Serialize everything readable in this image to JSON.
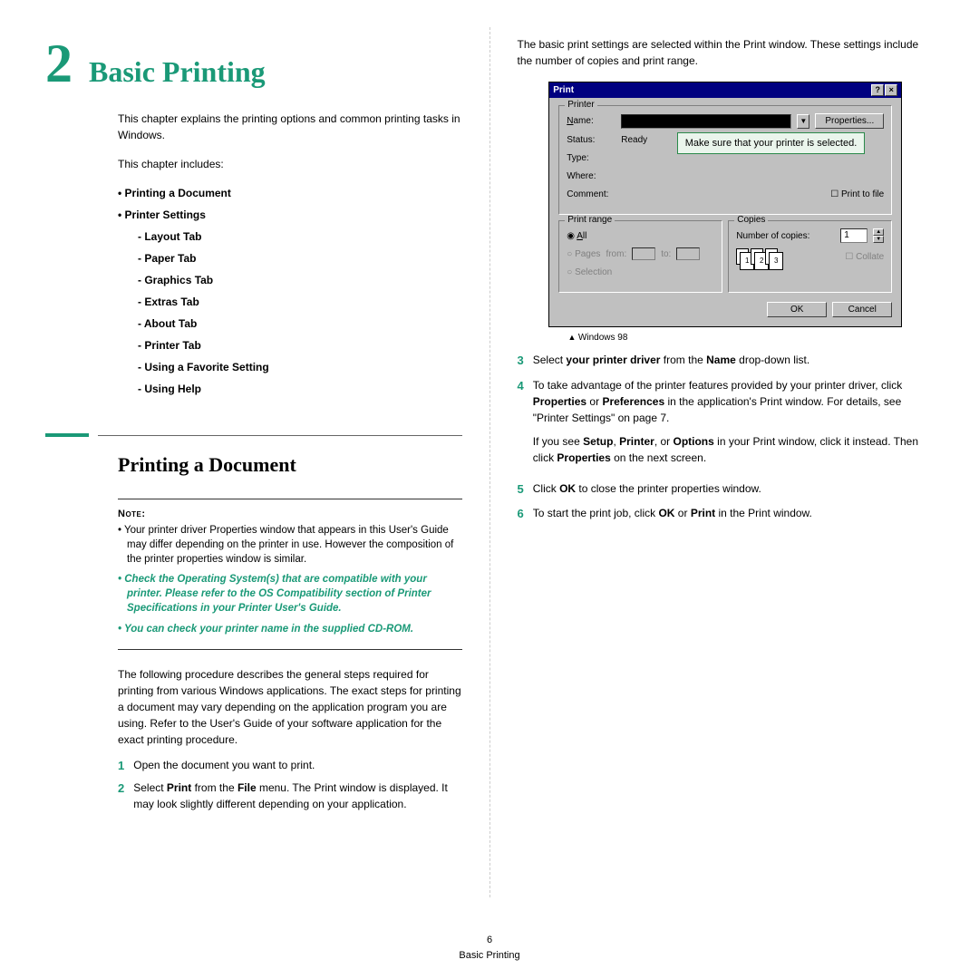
{
  "chapter": {
    "num": "2",
    "title": "Basic Printing"
  },
  "intro1": "This chapter explains the printing options and common printing tasks in Windows.",
  "intro2": "This chapter includes:",
  "toc": {
    "i1": "Printing a Document",
    "i2": "Printer Settings",
    "s1": "Layout Tab",
    "s2": "Paper Tab",
    "s3": "Graphics Tab",
    "s4": "Extras Tab",
    "s5": "About Tab",
    "s6": "Printer Tab",
    "s7": "Using a Favorite Setting",
    "s8": "Using Help"
  },
  "section1": "Printing a Document",
  "note_label": "Note:",
  "note": {
    "n1": "Your printer driver Properties window that appears in this User's Guide may differ depending on the printer in use. However the composition of the printer properties window is similar.",
    "n2": "Check the Operating System(s) that are compatible with your printer. Please refer to the OS Compatibility section of Printer Specifications in your Printer User's Guide.",
    "n3": "You can check your printer name in the supplied CD-ROM."
  },
  "para1": "The following procedure describes the general steps required for printing from various Windows applications. The exact steps for printing a document may vary depending on the application program you are using. Refer to the User's Guide of your software application for the exact printing procedure.",
  "step1": "Open the document you want to print.",
  "step2_a": "Select ",
  "step2_b": "Print",
  "step2_c": " from the ",
  "step2_d": "File",
  "step2_e": " menu. The Print window is displayed. It may look slightly different depending on your application.",
  "col2_top": "The basic print settings are selected within the Print window. These settings include the number of copies and print range.",
  "dlg": {
    "title": "Print",
    "printer": "Printer",
    "name": "Name:",
    "properties": "Properties...",
    "status": "Status:",
    "status_v": "Ready",
    "type": "Type:",
    "where": "Where:",
    "comment": "Comment:",
    "print_to_file": "Print to file",
    "print_range": "Print range",
    "all": "All",
    "pages": "Pages",
    "from": "from:",
    "to": "to:",
    "selection": "Selection",
    "copies": "Copies",
    "num_copies": "Number of copies:",
    "copies_v": "1",
    "collate": "Collate",
    "ok": "OK",
    "cancel": "Cancel",
    "callout": "Make sure that your printer is selected."
  },
  "caption": "Windows 98",
  "s3_a": "Select ",
  "s3_b": "your printer driver",
  "s3_c": " from the ",
  "s3_d": "Name",
  "s3_e": " drop-down list.",
  "s4_a": "To take advantage of the printer features provided by your printer driver, click ",
  "s4_b": "Properties",
  "s4_c": " or ",
  "s4_d": "Preferences",
  "s4_e": " in the application's Print window. For details, see \"Printer Settings\" on page 7.",
  "s4_p2_a": "If you see ",
  "s4_p2_b": "Setup",
  "s4_p2_c": ", ",
  "s4_p2_d": "Printer",
  "s4_p2_e": ", or ",
  "s4_p2_f": "Options",
  "s4_p2_g": " in your Print window, click it instead. Then click ",
  "s4_p2_h": "Properties",
  "s4_p2_i": " on the next screen.",
  "s5_a": "Click ",
  "s5_b": "OK",
  "s5_c": " to close the printer properties window.",
  "s6_a": "To start the print job, click ",
  "s6_b": "OK",
  "s6_c": " or ",
  "s6_d": "Print",
  "s6_e": " in the Print window.",
  "footer": {
    "page": "6",
    "label": "Basic Printing"
  }
}
